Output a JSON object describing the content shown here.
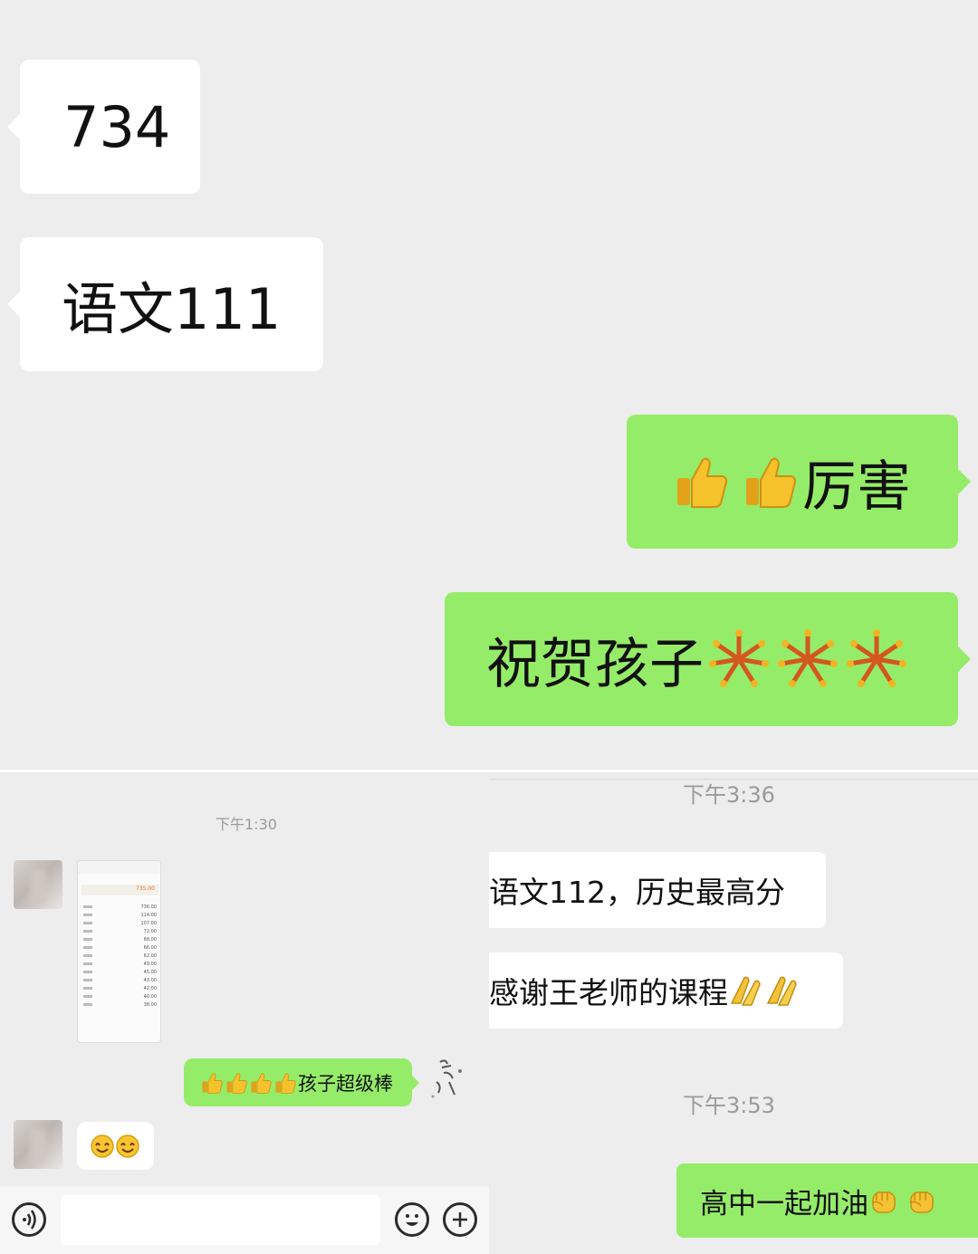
{
  "top_chat": {
    "messages": [
      {
        "side": "left",
        "text": "734"
      },
      {
        "side": "left",
        "text": "语文111"
      },
      {
        "side": "right",
        "text": "厉害",
        "emoji_prefix": [
          "thumbs-up-icon",
          "thumbs-up-icon"
        ]
      },
      {
        "side": "right",
        "text": "祝贺孩子",
        "emoji_suffix": [
          "fireworks-icon",
          "fireworks-icon",
          "fireworks-icon"
        ]
      }
    ]
  },
  "left_chat": {
    "timestamp": "下午1:30",
    "image_message": {
      "summary_value": "735.00",
      "rows": [
        "736.00",
        "114.00",
        "107.00",
        "72.00",
        "68.00",
        "66.00",
        "62.00",
        "49.00",
        "45.00",
        "43.00",
        "42.00",
        "40.00",
        "38.00"
      ]
    },
    "sent_message": {
      "text": "孩子超级棒",
      "emoji_prefix": [
        "thumbs-up-icon",
        "thumbs-up-icon",
        "thumbs-up-icon",
        "thumbs-up-icon"
      ]
    },
    "reply_emojis": [
      "smile-icon",
      "smile-icon"
    ],
    "input_bar": {
      "voice_icon": "voice-icon",
      "emoji_icon": "emoji-icon",
      "plus_icon": "plus-icon"
    }
  },
  "right_chat": {
    "timestamp_1": "下午3:36",
    "messages": [
      {
        "side": "left",
        "text": "语文112，历史最高分"
      },
      {
        "side": "left",
        "text": "感谢王老师的课程",
        "emoji_suffix": [
          "clapping-icon",
          "clapping-icon"
        ]
      }
    ],
    "timestamp_2": "下午3:53",
    "sent_message": {
      "text": "高中一起加油",
      "emoji_suffix": [
        "fist-icon",
        "fist-icon"
      ]
    }
  },
  "colors": {
    "background": "#ededed",
    "green_bubble": "#95ec69",
    "white_bubble": "#ffffff",
    "timestamp": "#9a9a9a"
  }
}
